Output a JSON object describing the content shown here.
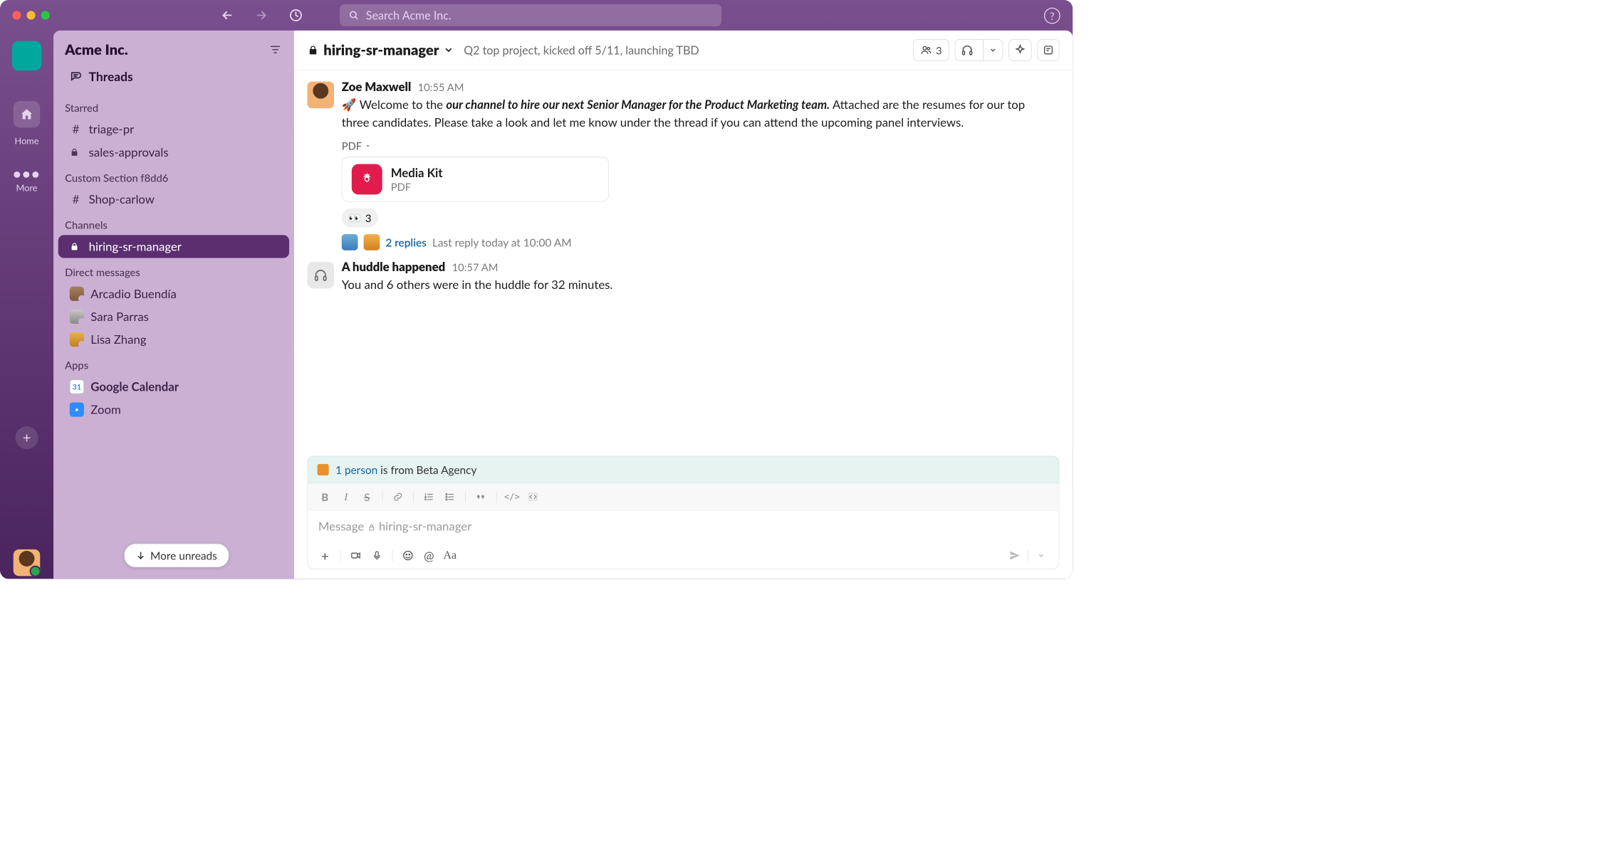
{
  "workspace": "Acme Inc.",
  "search_placeholder": "Search Acme Inc.",
  "rail": {
    "home": "Home",
    "more": "More"
  },
  "sidebar": {
    "threads": "Threads",
    "sections": [
      {
        "label": "Starred",
        "items": [
          {
            "prefix": "#",
            "name": "triage-pr"
          },
          {
            "prefix": "lock",
            "name": "sales-approvals"
          }
        ]
      },
      {
        "label": "Custom Section f8dd6",
        "items": [
          {
            "prefix": "#",
            "name": "Shop-carlow"
          }
        ]
      },
      {
        "label": "Channels",
        "items": [
          {
            "prefix": "lock",
            "name": "hiring-sr-manager",
            "active": true
          }
        ]
      },
      {
        "label": "Direct messages",
        "items": [
          {
            "dm": true,
            "name": "Arcadio Buendía"
          },
          {
            "dm": true,
            "name": "Sara Parras"
          },
          {
            "dm": true,
            "name": "Lisa Zhang"
          }
        ]
      },
      {
        "label": "Apps",
        "items": [
          {
            "app": "gcal",
            "name": "Google Calendar",
            "bold": true
          },
          {
            "app": "zoom",
            "name": "Zoom"
          }
        ]
      }
    ],
    "more_unreads": "More unreads"
  },
  "channel": {
    "name": "hiring-sr-manager",
    "topic": "Q2 top project, kicked off 5/11, launching TBD",
    "member_count": "3"
  },
  "messages": [
    {
      "author": "Zoe Maxwell",
      "time": "10:55 AM",
      "text_prefix": "🚀  Welcome to the ",
      "text_italic": "our channel to hire our next Senior Manager for the Product Marketing team.",
      "text_rest": " Attached are the resumes for our top three candidates. Please take a look and let me know under the thread if you can attend the upcoming panel interviews.",
      "pdf_label": "PDF",
      "attachment": {
        "name": "Media Kit",
        "type": "PDF"
      },
      "reaction": {
        "emoji": "👀",
        "count": "3"
      },
      "replies": {
        "count": "2 replies",
        "meta": "Last reply today at 10:00 AM"
      }
    },
    {
      "huddle": true,
      "title": "A huddle happened",
      "time": "10:57 AM",
      "text": "You and 6 others were in the huddle for 32 minutes."
    }
  ],
  "notice": {
    "link_text": "1 person",
    "rest": " is from Beta Agency"
  },
  "composer": {
    "placeholder_prefix": "Message ",
    "placeholder_channel": "hiring-sr-manager"
  }
}
